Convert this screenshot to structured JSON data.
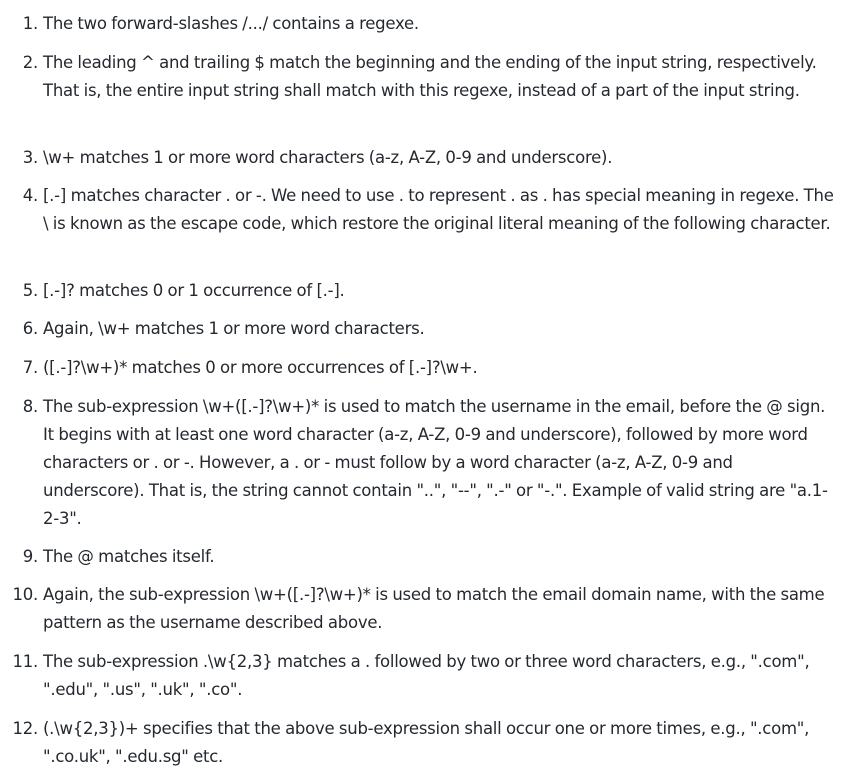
{
  "items": [
    {
      "number": "1.",
      "text": "The two forward-slashes /.../ contains a regexe."
    },
    {
      "number": "2.",
      "text": "The leading ^ and trailing $ match the beginning and the ending of the input string, respectively. That is, the entire input string shall match with this regexe, instead of a part of the input string."
    },
    {
      "number": "3.",
      "text": "\\w+ matches 1 or more word characters (a-z, A-Z, 0-9 and underscore)."
    },
    {
      "number": "4.",
      "text": "[.-] matches character . or -. We need to use . to represent . as . has special meaning in regexe. The \\ is known as the escape code, which restore the original literal meaning of the following character."
    },
    {
      "number": "5.",
      "text": "[.-]? matches 0 or 1 occurrence of [.-]."
    },
    {
      "number": "6.",
      "text": "Again, \\w+ matches 1 or more word characters."
    },
    {
      "number": "7.",
      "text": "([.-]?\\w+)* matches 0 or more occurrences of [.-]?\\w+."
    },
    {
      "number": "8.",
      "text": "The sub-expression \\w+([.-]?\\w+)* is used to match the username in the email, before the @ sign. It begins with at least one word character (a-z, A-Z, 0-9 and underscore), followed by more word characters or . or -. However, a . or - must follow by a word character (a-z, A-Z, 0-9 and underscore). That is, the string cannot contain \"..\", \"--\", \".-\" or \"-.\". Example of valid string are \"a.1-2-3\"."
    },
    {
      "number": "9.",
      "text": "The @ matches itself."
    },
    {
      "number": "10.",
      "text": "Again, the sub-expression \\w+([.-]?\\w+)* is used to match the email domain name, with the same pattern as the username described above."
    },
    {
      "number": "11.",
      "text": "The sub-expression .\\w{2,3} matches a . followed by two or three word characters, e.g., \".com\", \".edu\", \".us\", \".uk\", \".co\"."
    },
    {
      "number": "12.",
      "text": "(.\\w{2,3})+ specifies that the above sub-expression shall occur one or more times, e.g., \".com\", \".co.uk\", \".edu.sg\" etc."
    }
  ]
}
